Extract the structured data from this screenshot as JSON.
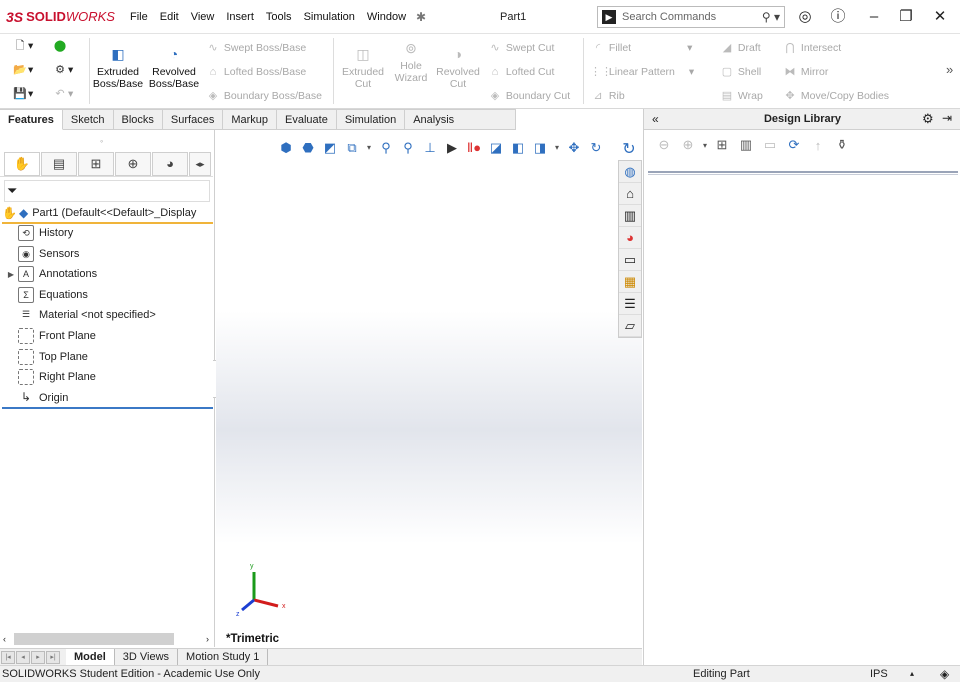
{
  "app": {
    "logo_ds": "3S",
    "logo_bold": "SOLID",
    "logo_italic": "WORKS",
    "doc_title": "Part1"
  },
  "menu": [
    "File",
    "Edit",
    "View",
    "Insert",
    "Tools",
    "Simulation",
    "Window"
  ],
  "search": {
    "placeholder": "Search Commands"
  },
  "commands": {
    "extruded_boss": "Extruded Boss/Base",
    "revolved_boss": "Revolved Boss/Base",
    "swept_boss": "Swept Boss/Base",
    "lofted_boss": "Lofted Boss/Base",
    "boundary_boss": "Boundary Boss/Base",
    "extruded_cut": "Extruded Cut",
    "hole_wizard": "Hole Wizard",
    "revolved_cut": "Revolved Cut",
    "swept_cut": "Swept Cut",
    "lofted_cut": "Lofted Cut",
    "boundary_cut": "Boundary Cut",
    "fillet": "Fillet",
    "linear_pattern": "Linear Pattern",
    "rib": "Rib",
    "draft": "Draft",
    "shell": "Shell",
    "wrap": "Wrap",
    "intersect": "Intersect",
    "mirror": "Mirror",
    "move_copy": "Move/Copy Bodies"
  },
  "tabs": [
    "Features",
    "Sketch",
    "Blocks",
    "Surfaces",
    "Markup",
    "Evaluate",
    "Simulation",
    "Analysis Preparation"
  ],
  "tree": {
    "part": "Part1  (Default<<Default>_Display",
    "items": [
      "History",
      "Sensors",
      "Annotations",
      "Equations",
      "Material <not specified>",
      "Front Plane",
      "Top Plane",
      "Right Plane",
      "Origin"
    ]
  },
  "graphics": {
    "view_label": "*Trimetric",
    "axis_x": "x",
    "axis_y": "y",
    "axis_z": "z"
  },
  "design_library": {
    "title": "Design Library"
  },
  "bottom_tabs": [
    "Model",
    "3D Views",
    "Motion Study 1"
  ],
  "status": {
    "left": "SOLIDWORKS Student Edition - Academic Use Only",
    "mode": "Editing Part",
    "units": "IPS"
  }
}
